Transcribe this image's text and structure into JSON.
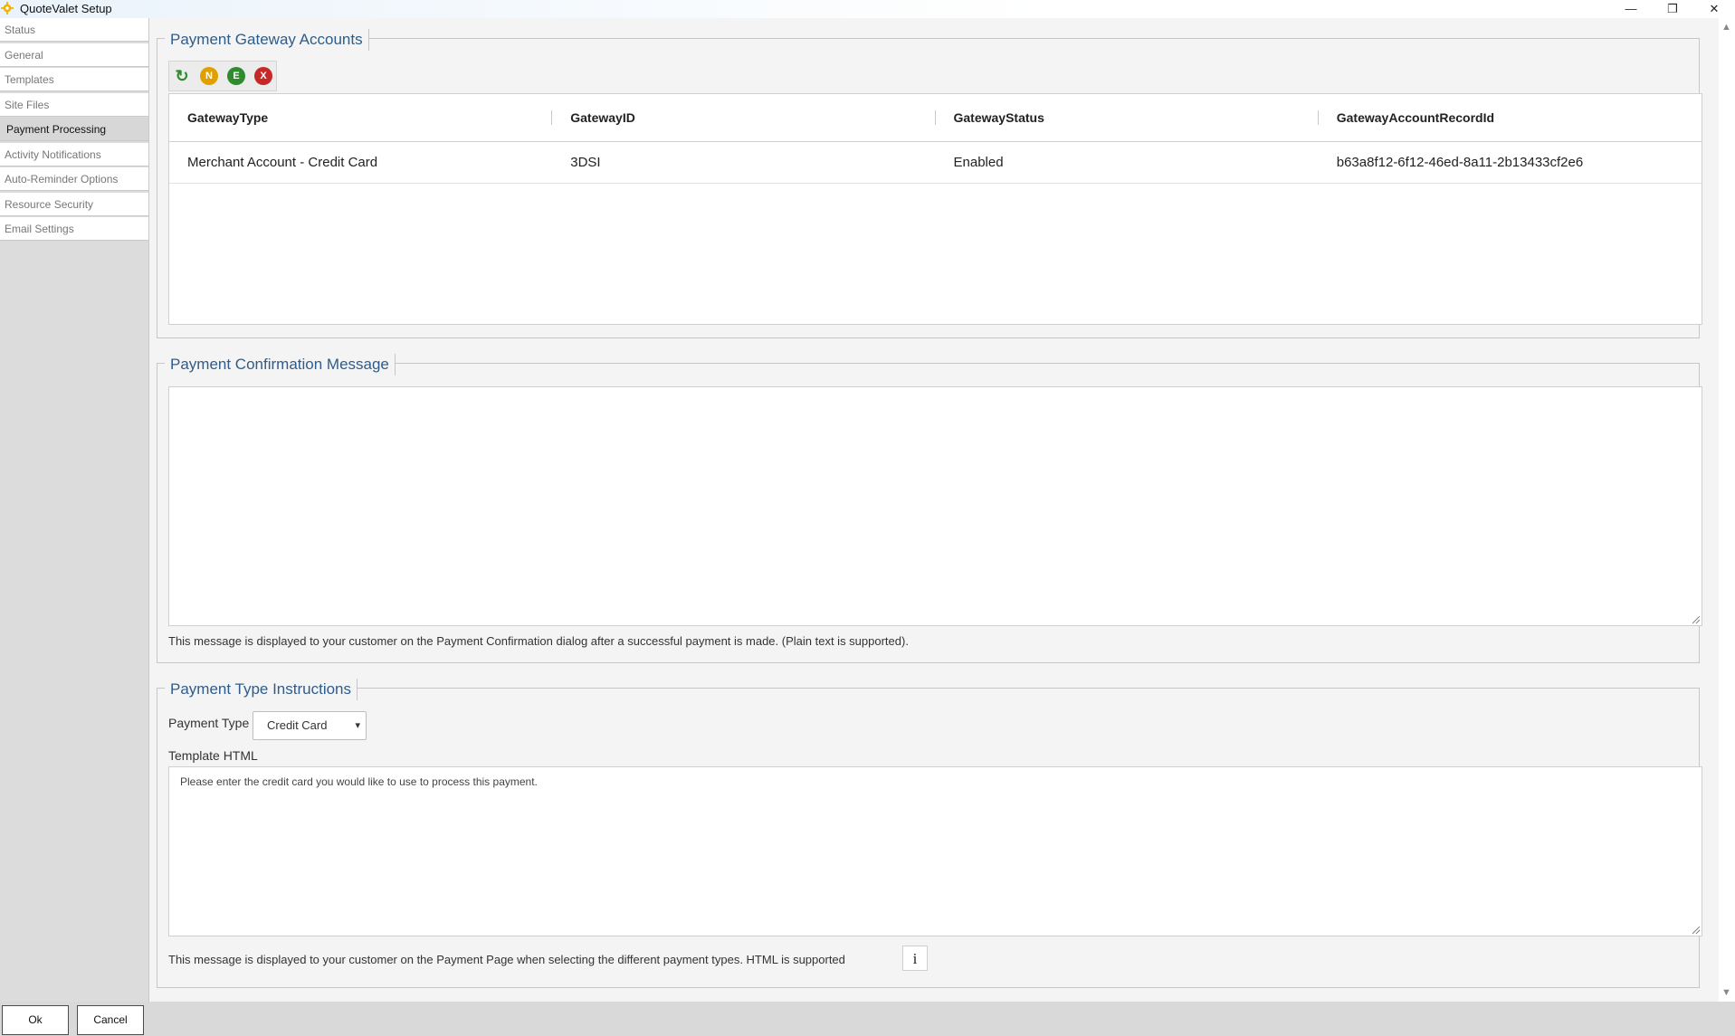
{
  "window": {
    "title": "QuoteValet Setup",
    "minimize": "—",
    "restore": "❐",
    "close": "✕"
  },
  "sidebar": {
    "items": [
      {
        "label": "Status"
      },
      {
        "label": "General"
      },
      {
        "label": "Templates"
      },
      {
        "label": "Site Files"
      },
      {
        "label": "Payment Processing",
        "active": true
      },
      {
        "label": "Activity Notifications"
      },
      {
        "label": "Auto-Reminder Options"
      },
      {
        "label": "Resource Security"
      },
      {
        "label": "Email Settings"
      }
    ]
  },
  "gateway": {
    "title": "Payment Gateway Accounts",
    "toolbar": {
      "refresh_icon": "↻",
      "new_label": "N",
      "edit_label": "E",
      "delete_label": "X"
    },
    "columns": [
      "GatewayType",
      "GatewayID",
      "GatewayStatus",
      "GatewayAccountRecordId"
    ],
    "rows": [
      [
        "Merchant Account - Credit Card",
        "3DSI",
        "Enabled",
        "b63a8f12-6f12-46ed-8a11-2b13433cf2e6"
      ]
    ]
  },
  "confirmation": {
    "title": "Payment Confirmation Message",
    "value": "",
    "note": "This message is displayed to your customer on the Payment Confirmation dialog after a successful payment is made. (Plain text is supported)."
  },
  "instructions": {
    "title": "Payment Type Instructions",
    "payment_type_label": "Payment Type",
    "payment_type_value": "Credit Card",
    "template_label": "Template HTML",
    "template_value": "Please enter the credit card you would like to use to process this payment.",
    "note": "This message is displayed to your customer on the Payment Page when selecting the different payment types. HTML is supported",
    "info_icon": "i"
  },
  "footer": {
    "ok_label": "Ok",
    "cancel_label": "Cancel"
  },
  "colors": {
    "accent": "#2f5c8a",
    "refresh": "#2e8b2e",
    "new": "#e0a100",
    "edit": "#2e8b2e",
    "delete": "#c62828"
  }
}
